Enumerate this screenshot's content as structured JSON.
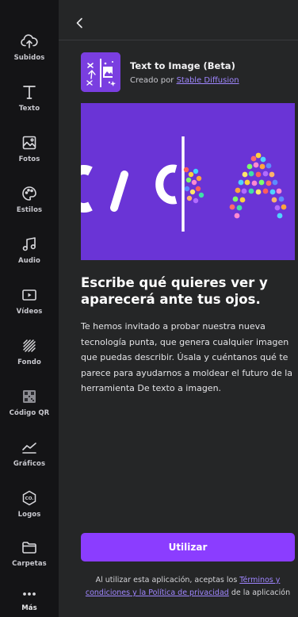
{
  "sidebar": {
    "items": [
      {
        "label": "Subidos",
        "icon": "cloud-upload-icon"
      },
      {
        "label": "Texto",
        "icon": "text-icon"
      },
      {
        "label": "Fotos",
        "icon": "image-icon"
      },
      {
        "label": "Estilos",
        "icon": "palette-icon"
      },
      {
        "label": "Audio",
        "icon": "music-note-icon"
      },
      {
        "label": "Vídeos",
        "icon": "video-icon"
      },
      {
        "label": "Fondo",
        "icon": "background-pattern-icon"
      },
      {
        "label": "Código QR",
        "icon": "qr-code-icon"
      },
      {
        "label": "Gráficos",
        "icon": "chart-icon"
      },
      {
        "label": "Logos",
        "icon": "logo-icon"
      },
      {
        "label": "Carpetas",
        "icon": "folder-icon"
      },
      {
        "label": "Más",
        "icon": "more-icon"
      }
    ]
  },
  "app": {
    "title": "Text to Image (Beta)",
    "creator_prefix": "Creado por ",
    "creator_link": "Stable Diffusion"
  },
  "main": {
    "heading": "Escribe qué quieres ver y aparecerá ante tus ojos.",
    "description": "Te hemos invitado a probar nuestra nueva tecnología punta, que genera cualquier imagen que puedas describir. Úsala y cuéntanos qué te parece para ayudarnos a moldear el futuro de la herramienta De texto a imagen.",
    "cta_label": "Utilizar"
  },
  "terms": {
    "prefix": "Al utilizar esta aplicación, aceptas los ",
    "link_terms": "Términos y condiciones",
    "middle": " y la ",
    "link_privacy": "Política de privacidad",
    "suffix": " de la aplicación"
  },
  "colors": {
    "accent": "#8b3dff",
    "hero_bg": "#6a34d6",
    "sidebar_bg": "#141416",
    "panel_bg": "#252627",
    "link": "#9f86ff"
  }
}
